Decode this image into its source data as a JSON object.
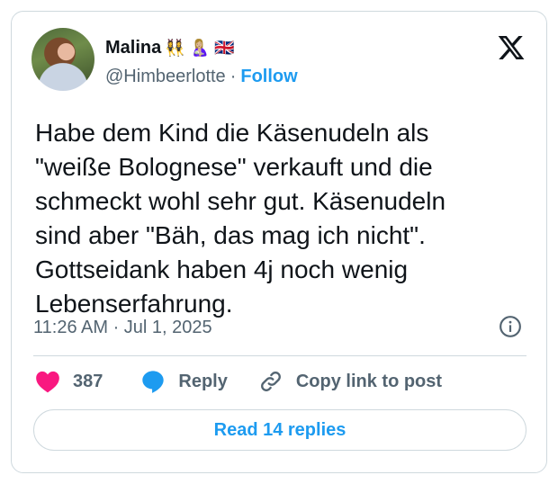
{
  "author": {
    "name": "Malina",
    "name_emojis": "👯‍♀️ 🤱🏼 🇬🇧",
    "handle": "@Himbeerlotte",
    "separator": "·",
    "follow_label": "Follow"
  },
  "tweet": {
    "text": "Habe dem Kind die Käsenudeln als\n\"weiße Bolognese\" verkauft und die\nschmeckt wohl sehr gut. Käsenudeln\nsind aber \"Bäh, das mag ich nicht\".\nGottseidank haben 4j noch wenig\nLebenserfahrung.",
    "timestamp": "11:26 AM · Jul 1, 2025"
  },
  "actions": {
    "like_count": "387",
    "reply_label": "Reply",
    "copy_link_label": "Copy link to post"
  },
  "footer": {
    "read_replies_label": "Read 14 replies"
  },
  "icons": {
    "logo": "x-logo-icon",
    "info": "info-icon",
    "like": "heart-icon",
    "reply": "speech-bubble-icon",
    "link": "link-icon"
  },
  "colors": {
    "accent": "#1d9bf0",
    "like": "#f91880",
    "muted": "#536471",
    "border": "#cfd9de"
  }
}
